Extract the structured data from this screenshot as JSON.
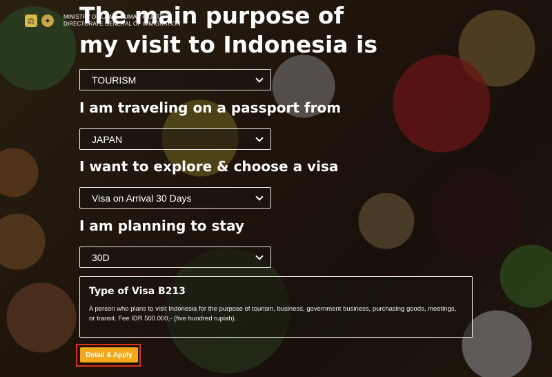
{
  "header": {
    "ministry_line1": "MINISTRY OF LAW & HUMAN RIGHTS",
    "ministry_line2": "DIRECTORATE GENERAL OF IMMIGRATION"
  },
  "form": {
    "headline": "The main purpose of my visit to Indonesia is",
    "purpose": {
      "value": "TOURISM"
    },
    "passport": {
      "label": "I am traveling on a passport from",
      "value": "JAPAN"
    },
    "visa": {
      "label": "I want to explore & choose a visa",
      "value": "Visa on Arrival 30 Days"
    },
    "stay": {
      "label": "I am planning to stay",
      "value": "30D"
    }
  },
  "visa_info": {
    "title": "Type of Visa B213",
    "description": "A person who plans to visit Indonesia for the purpose of tourism, business, government business, purchasing goods, meetings, or transit. Fee IDR 500.000,- (five hundred rupiah)."
  },
  "actions": {
    "detail_apply_label": "Detail & Apply"
  },
  "colors": {
    "accent": "#f4a91c",
    "highlight_frame": "#e0301e"
  },
  "icons": [
    "ministry-emblem-icon",
    "immigration-emblem-icon",
    "chevron-down-icon"
  ]
}
